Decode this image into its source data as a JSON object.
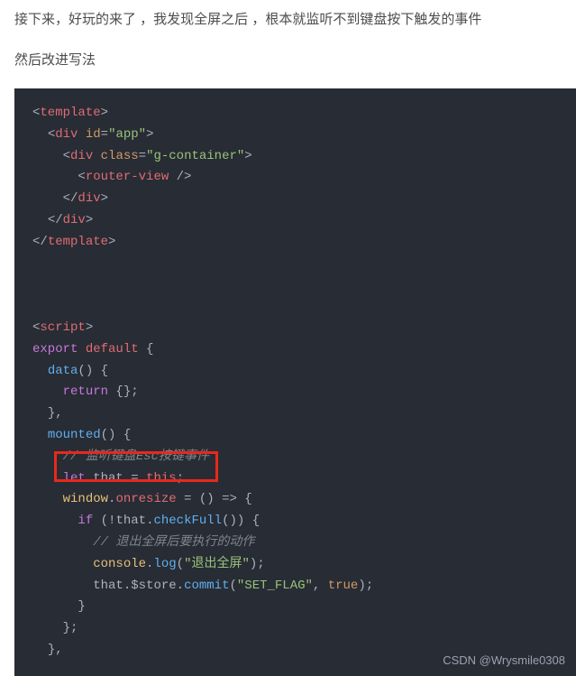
{
  "article": {
    "p1": "接下来，好玩的来了 ，我发现全屏之后 ，根本就监听不到键盘按下触发的事件",
    "p2": "然后改进写法"
  },
  "code": {
    "l1_open": "<",
    "l1_tag": "template",
    "l1_close": ">",
    "l2_open": "<",
    "l2_tag": "div",
    "l2_attr": "id",
    "l2_eq": "=",
    "l2_val": "\"app\"",
    "l2_close": ">",
    "l3_open": "<",
    "l3_tag": "div",
    "l3_attr": "class",
    "l3_eq": "=",
    "l3_val": "\"g-container\"",
    "l3_close": ">",
    "l4_open": "<",
    "l4_tag": "router-view",
    "l4_close": " />",
    "l5_open": "</",
    "l5_tag": "div",
    "l5_close": ">",
    "l6_open": "</",
    "l6_tag": "div",
    "l6_close": ">",
    "l7_open": "</",
    "l7_tag": "template",
    "l7_close": ">",
    "l8_open": "<",
    "l8_tag": "script",
    "l8_close": ">",
    "l9_export": "export",
    "l9_default": " default",
    "l9_brace": " {",
    "l10_fn": "data",
    "l10_paren": "() {",
    "l11_return": "return",
    "l11_val": " {};",
    "l12_close": "},",
    "l13_fn": "mounted",
    "l13_paren": "() {",
    "l14_comment": "// 监听键盘Esc按键事件",
    "l15_let": "let",
    "l15_that": " that",
    "l15_eq": " = ",
    "l15_this": "this",
    "l15_semi": ";",
    "l16_window": "window",
    "l16_dot": ".",
    "l16_prop": "onresize",
    "l16_eq": " = ",
    "l16_arrow": "() => {",
    "l17_if": "if",
    "l17_open": " (!",
    "l17_that": "that",
    "l17_dot": ".",
    "l17_fn": "checkFull",
    "l17_close": "()) {",
    "l18_comment": "// 退出全屏后要执行的动作",
    "l19_console": "console",
    "l19_dot": ".",
    "l19_log": "log",
    "l19_open": "(",
    "l19_str": "\"退出全屏\"",
    "l19_close": ");",
    "l20_that": "that",
    "l20_dot1": ".",
    "l20_store": "$store",
    "l20_dot2": ".",
    "l20_commit": "commit",
    "l20_open": "(",
    "l20_str": "\"SET_FLAG\"",
    "l20_comma": ", ",
    "l20_true": "true",
    "l20_close": ");",
    "l21_close": "}",
    "l22_close": "};",
    "l23_close": "},"
  },
  "watermark": "CSDN @Wrysmile0308"
}
